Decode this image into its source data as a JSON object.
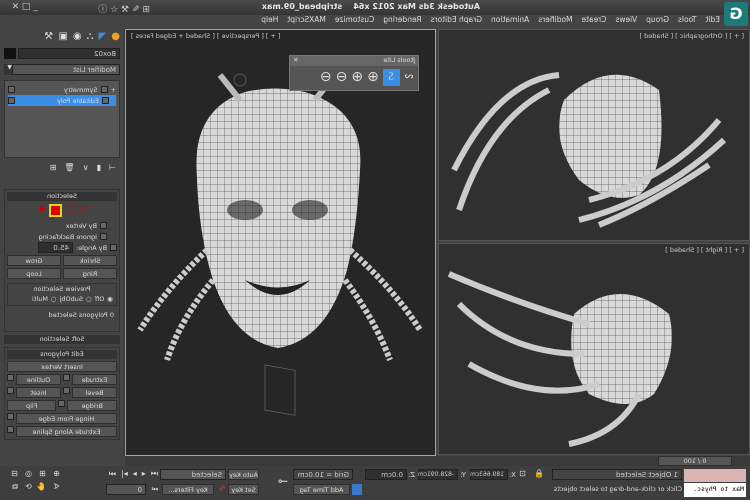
{
  "title": {
    "app": "Autodesk 3ds Max 2012 x64",
    "file": "stripbead_09.max",
    "logo": "G"
  },
  "menu": [
    "Edit",
    "Tools",
    "Group",
    "Views",
    "Create",
    "Modifiers",
    "Animation",
    "Graph Editors",
    "Rendering",
    "Customize",
    "MAXScript",
    "Help"
  ],
  "viewports": {
    "top_left": "[ + ] [ Orthographic ] [ Shaded ]",
    "bottom_left": "[ + ] [ Right ] [ Shaded ]",
    "main": "[ + ] [ Perspective ] [ Shaded + Edged Faces ]"
  },
  "jtools": {
    "title": "Jtools Lite",
    "close": "✕",
    "buttons": [
      "loop-icon",
      "ring-icon",
      "grow-icon",
      "grow-more-icon",
      "shrink-icon",
      "shrink-more-icon"
    ]
  },
  "panel": {
    "object_name": "Box02",
    "modifier_list": "Modifier List",
    "stack": [
      "Symmetry",
      "Editable Poly"
    ],
    "selection": {
      "header": "Selection",
      "by_vertex": "By Vertex",
      "ignore_backfacing": "Ignore Backfacing",
      "by_angle": "By Angle:",
      "angle_value": "45.0",
      "shrink": "Shrink",
      "grow": "Grow",
      "ring": "Ring",
      "loop": "Loop",
      "preview_selection": "Preview Selection",
      "off": "Off",
      "subobj": "SubObj",
      "multi": "Multi",
      "status": "0 Polygons Selected"
    },
    "soft_selection": "Soft Selection",
    "edit_polygons": {
      "header": "Edit Polygons",
      "insert_vertex": "Insert Vertex",
      "extrude": "Extrude",
      "outline": "Outline",
      "bevel": "Bevel",
      "inset": "Inset",
      "bridge": "Bridge",
      "flip": "Flip",
      "hinge": "Hinge From Edge",
      "extrude_spline": "Extrude Along Spline"
    }
  },
  "timeline": {
    "frame": "0 / 100"
  },
  "status": {
    "maxscript": "Max to Physc.",
    "selected": "1 Object Selected",
    "prompt": "Click or click-and-drag to select objects",
    "x_label": "X:",
    "x": "189.663cm",
    "y_label": "Y:",
    "y": "-828.091cm",
    "z_label": "Z:",
    "z": "0.0cm",
    "grid": "Grid = 10.0cm",
    "add_time_tag": "Add Time Tag",
    "auto_key": "Auto Key",
    "set_key": "Set Key",
    "selected_dropdown": "Selected",
    "key_filters": "Key Filters...",
    "frame_field": "0"
  },
  "colors": {
    "accent": "#3a8ee6",
    "selection_active": "#e8d21a",
    "viewport_bg": "#2c2c2c"
  }
}
